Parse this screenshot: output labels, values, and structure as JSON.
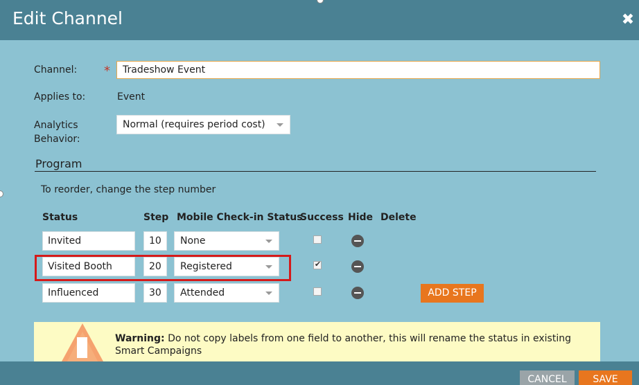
{
  "dialog": {
    "title": "Edit Channel",
    "close_glyph": "✖"
  },
  "form": {
    "channel_label": "Channel:",
    "required_mark": "*",
    "channel_value": "Tradeshow Event",
    "applies_label": "Applies to:",
    "applies_value": "Event",
    "analytics_label_line1": "Analytics",
    "analytics_label_line2": "Behavior:",
    "analytics_value": "Normal (requires period cost)"
  },
  "program": {
    "section_title": "Program",
    "hint": "To reorder, change the step number",
    "columns": {
      "status": "Status",
      "step": "Step",
      "mobile": "Mobile Check-in Status",
      "success": "Success",
      "hide": "Hide",
      "delete": "Delete"
    },
    "rows": [
      {
        "status": "Invited",
        "step": "10",
        "mobile": "None",
        "success": false
      },
      {
        "status": "Visited Booth",
        "step": "20",
        "mobile": "Registered",
        "success": true
      },
      {
        "status": "Influenced",
        "step": "30",
        "mobile": "Attended",
        "success": false
      }
    ],
    "add_step_label": "ADD STEP"
  },
  "warning": {
    "label": "Warning:",
    "text": " Do not copy labels from one field to another, this will rename the status in existing Smart Campaigns"
  },
  "footer": {
    "cancel_label": "CANCEL",
    "save_label": "SAVE"
  },
  "colors": {
    "header_bg": "#4a8193",
    "body_bg": "#8cc2d2",
    "accent_orange": "#e8761e",
    "highlight_red": "#d51a1a",
    "warning_bg": "#fdfbc4"
  },
  "icons": {
    "close": "close-icon",
    "caret": "chevron-down-icon",
    "hide": "minus-circle-icon",
    "warning": "warning-triangle-icon"
  }
}
